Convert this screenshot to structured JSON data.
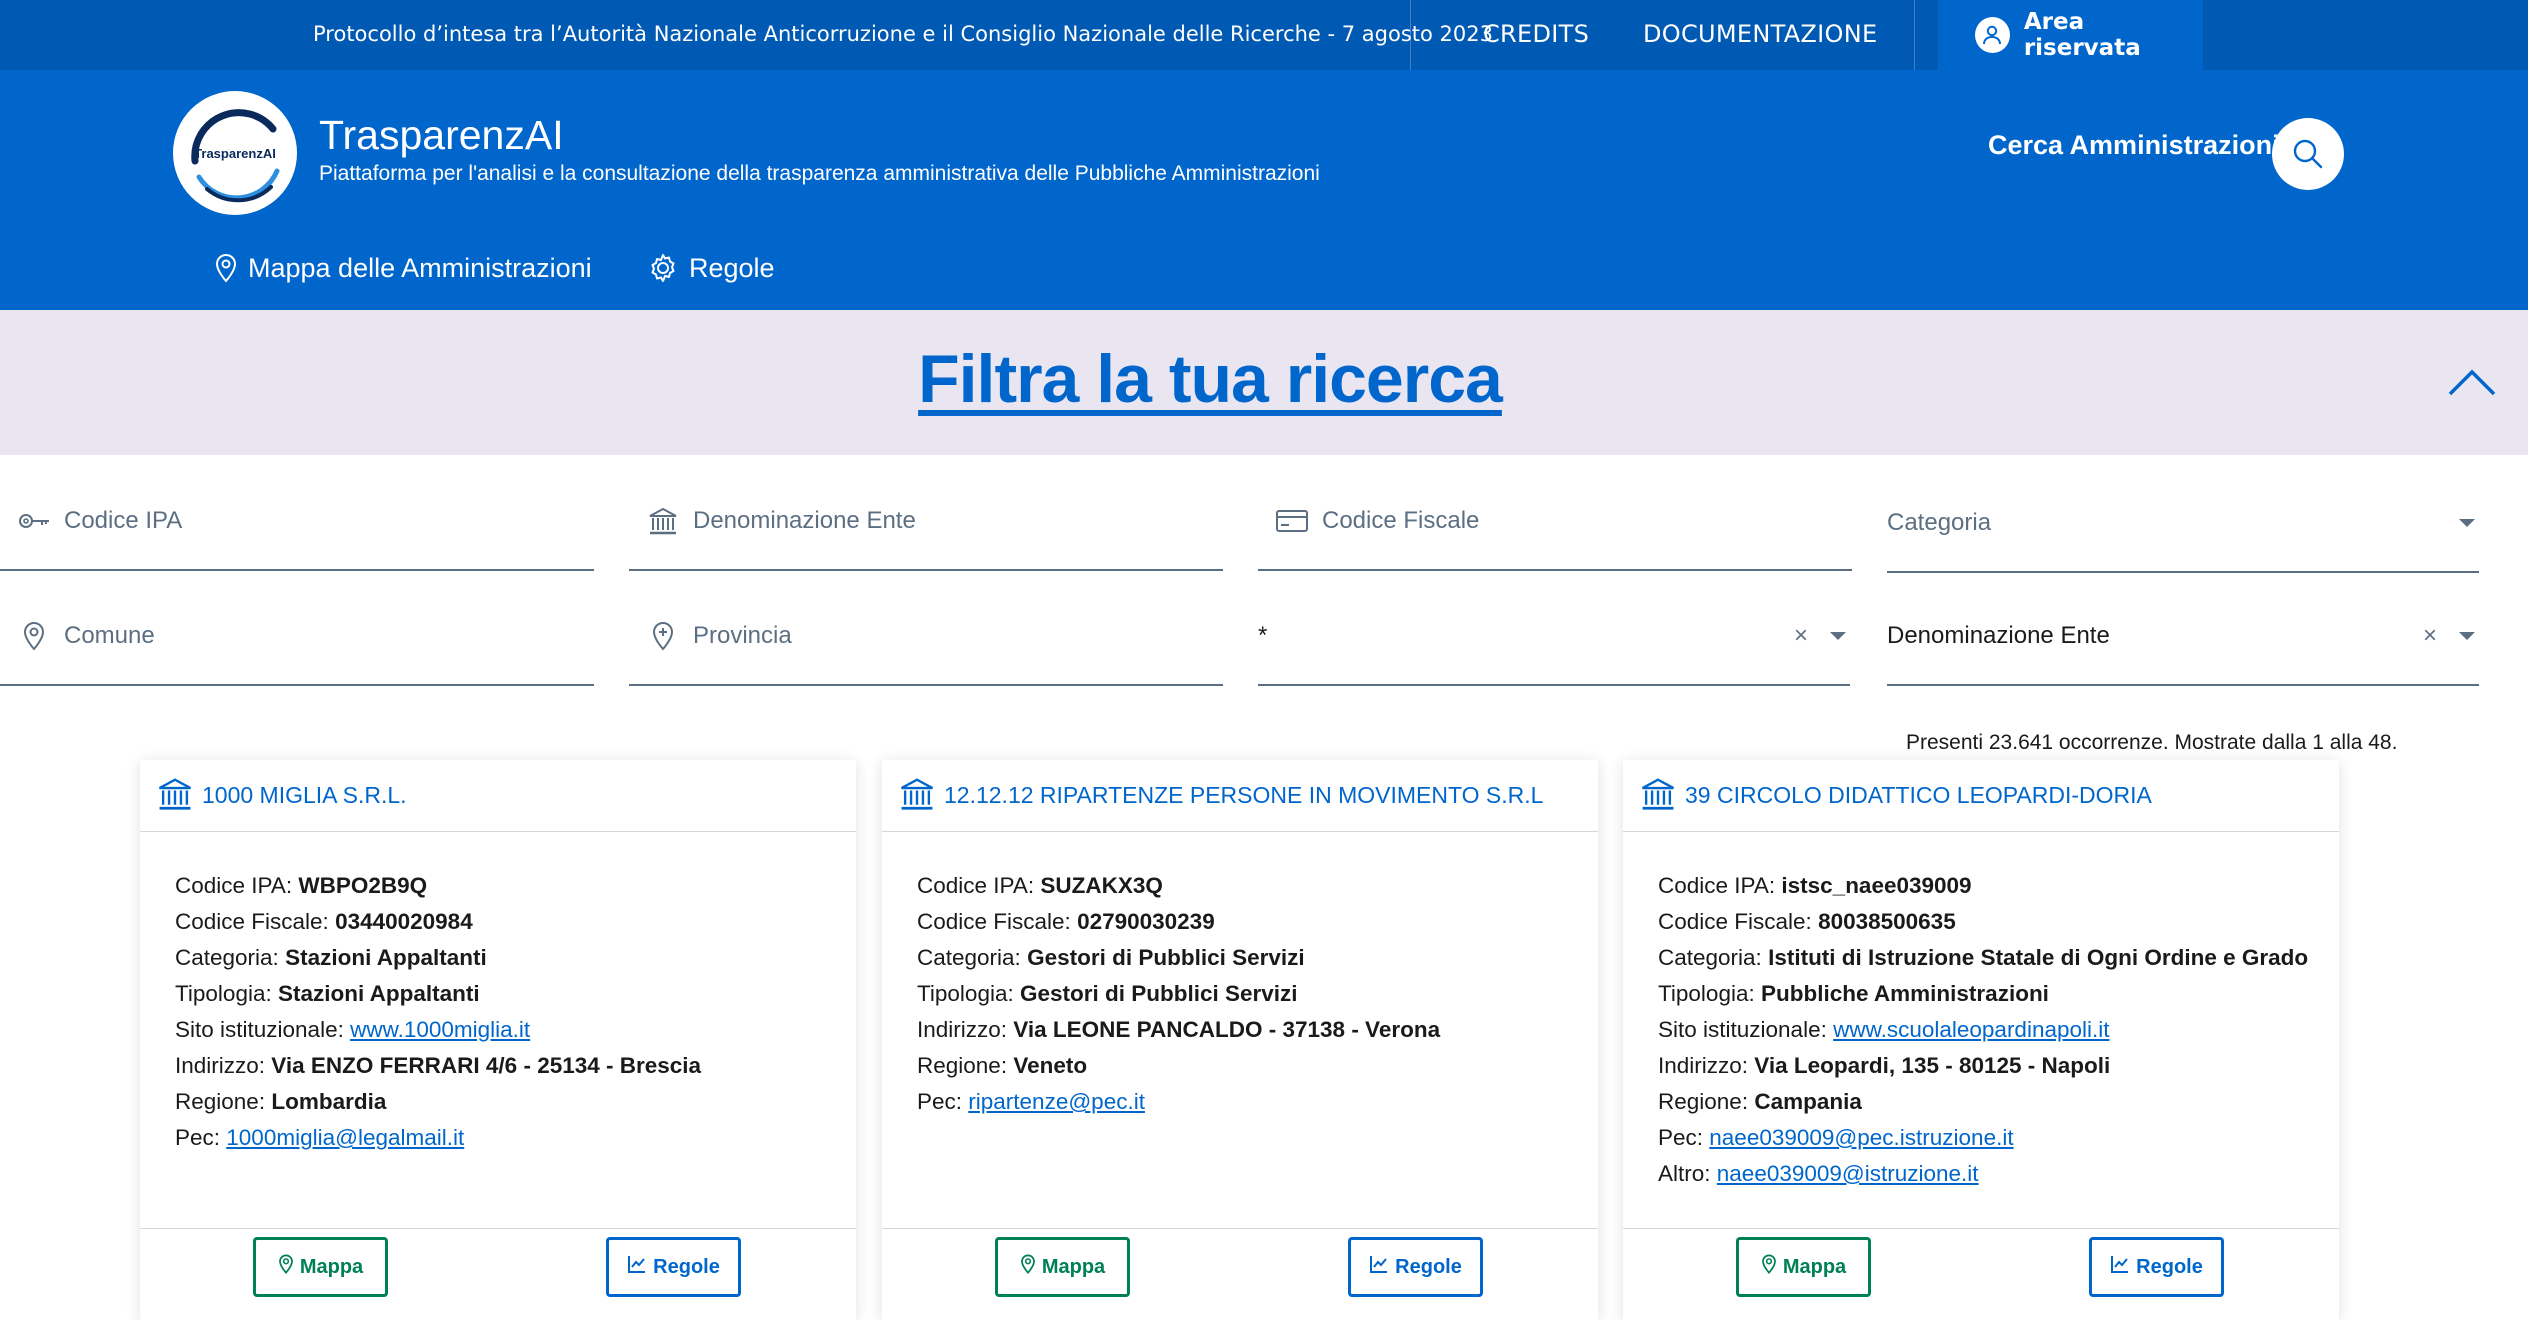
{
  "topbar": {
    "protocol": "Protocollo d’intesa tra l’Autorità Nazionale Anticorruzione e il Consiglio Nazionale delle Ricerche - 7 agosto 2023",
    "credits": "CREDITS",
    "documentazione": "DOCUMENTAZIONE",
    "area_riservata": "Area riservata"
  },
  "header": {
    "logo_text": "TrasparenzAI",
    "title": "TrasparenzAI",
    "subtitle": "Piattaforma per l'analisi e la consultazione della trasparenza amministrativa delle Pubbliche Amministrazioni",
    "search_label": "Cerca Amministrazioni",
    "nav": [
      {
        "label": "Mappa delle Amministrazioni",
        "icon": "map-pin-icon"
      },
      {
        "label": "Regole",
        "icon": "gear-icon"
      }
    ]
  },
  "filter": {
    "title": "Filtra la tua ricerca",
    "fields": {
      "codice_ipa": "Codice IPA",
      "denominazione": "Denominazione Ente",
      "codice_fiscale": "Codice Fiscale",
      "categoria": "Categoria",
      "comune": "Comune",
      "provincia": "Provincia",
      "wildcard_select": "*",
      "sort_select": "Denominazione Ente"
    },
    "clear_symbol": "×"
  },
  "results": {
    "count_text": "Presenti 23.641 occorrenze. Mostrate dalla 1 alla 48.",
    "mappa_label": "Mappa",
    "regole_label": "Regole",
    "cards": [
      {
        "title": "1000 MIGLIA S.R.L.",
        "rows": [
          {
            "label": "Codice IPA: ",
            "value": "WBPO2B9Q"
          },
          {
            "label": "Codice Fiscale: ",
            "value": "03440020984"
          },
          {
            "label": "Categoria: ",
            "value": "Stazioni Appaltanti"
          },
          {
            "label": "Tipologia: ",
            "value": "Stazioni Appaltanti"
          },
          {
            "label": "Sito istituzionale: ",
            "link": "www.1000miglia.it"
          },
          {
            "label": "Indirizzo: ",
            "value": "Via ENZO FERRARI 4/6 - 25134 - Brescia"
          },
          {
            "label": "Regione: ",
            "value": "Lombardia"
          },
          {
            "label": "Pec: ",
            "link": "1000miglia@legalmail.it"
          }
        ]
      },
      {
        "title": "12.12.12 RIPARTENZE PERSONE IN MOVIMENTO S.R.L",
        "rows": [
          {
            "label": "Codice IPA: ",
            "value": "SUZAKX3Q"
          },
          {
            "label": "Codice Fiscale: ",
            "value": "02790030239"
          },
          {
            "label": "Categoria: ",
            "value": "Gestori di Pubblici Servizi"
          },
          {
            "label": "Tipologia: ",
            "value": "Gestori di Pubblici Servizi"
          },
          {
            "label": "Indirizzo: ",
            "value": "Via LEONE PANCALDO - 37138 - Verona"
          },
          {
            "label": "Regione: ",
            "value": "Veneto"
          },
          {
            "label": "Pec: ",
            "link": "ripartenze@pec.it"
          }
        ]
      },
      {
        "title": "39 CIRCOLO DIDATTICO LEOPARDI-DORIA",
        "rows": [
          {
            "label": "Codice IPA: ",
            "value": "istsc_naee039009"
          },
          {
            "label": "Codice Fiscale: ",
            "value": "80038500635"
          },
          {
            "label": "Categoria: ",
            "value": "Istituti di Istruzione Statale di Ogni Ordine e Grado"
          },
          {
            "label": "Tipologia: ",
            "value": "Pubbliche Amministrazioni"
          },
          {
            "label": "Sito istituzionale: ",
            "link": "www.scuolaleopardinapoli.it"
          },
          {
            "label": "Indirizzo: ",
            "value": "Via Leopardi, 135 - 80125 - Napoli"
          },
          {
            "label": "Regione: ",
            "value": "Campania"
          },
          {
            "label": "Pec: ",
            "link": "naee039009@pec.istruzione.it"
          },
          {
            "label": "Altro: ",
            "link": "naee039009@istruzione.it"
          }
        ]
      }
    ]
  },
  "colors": {
    "primary": "#0066cc",
    "topbar": "#0059b3",
    "success": "#008055",
    "filter_band": "#e9e6f2"
  }
}
